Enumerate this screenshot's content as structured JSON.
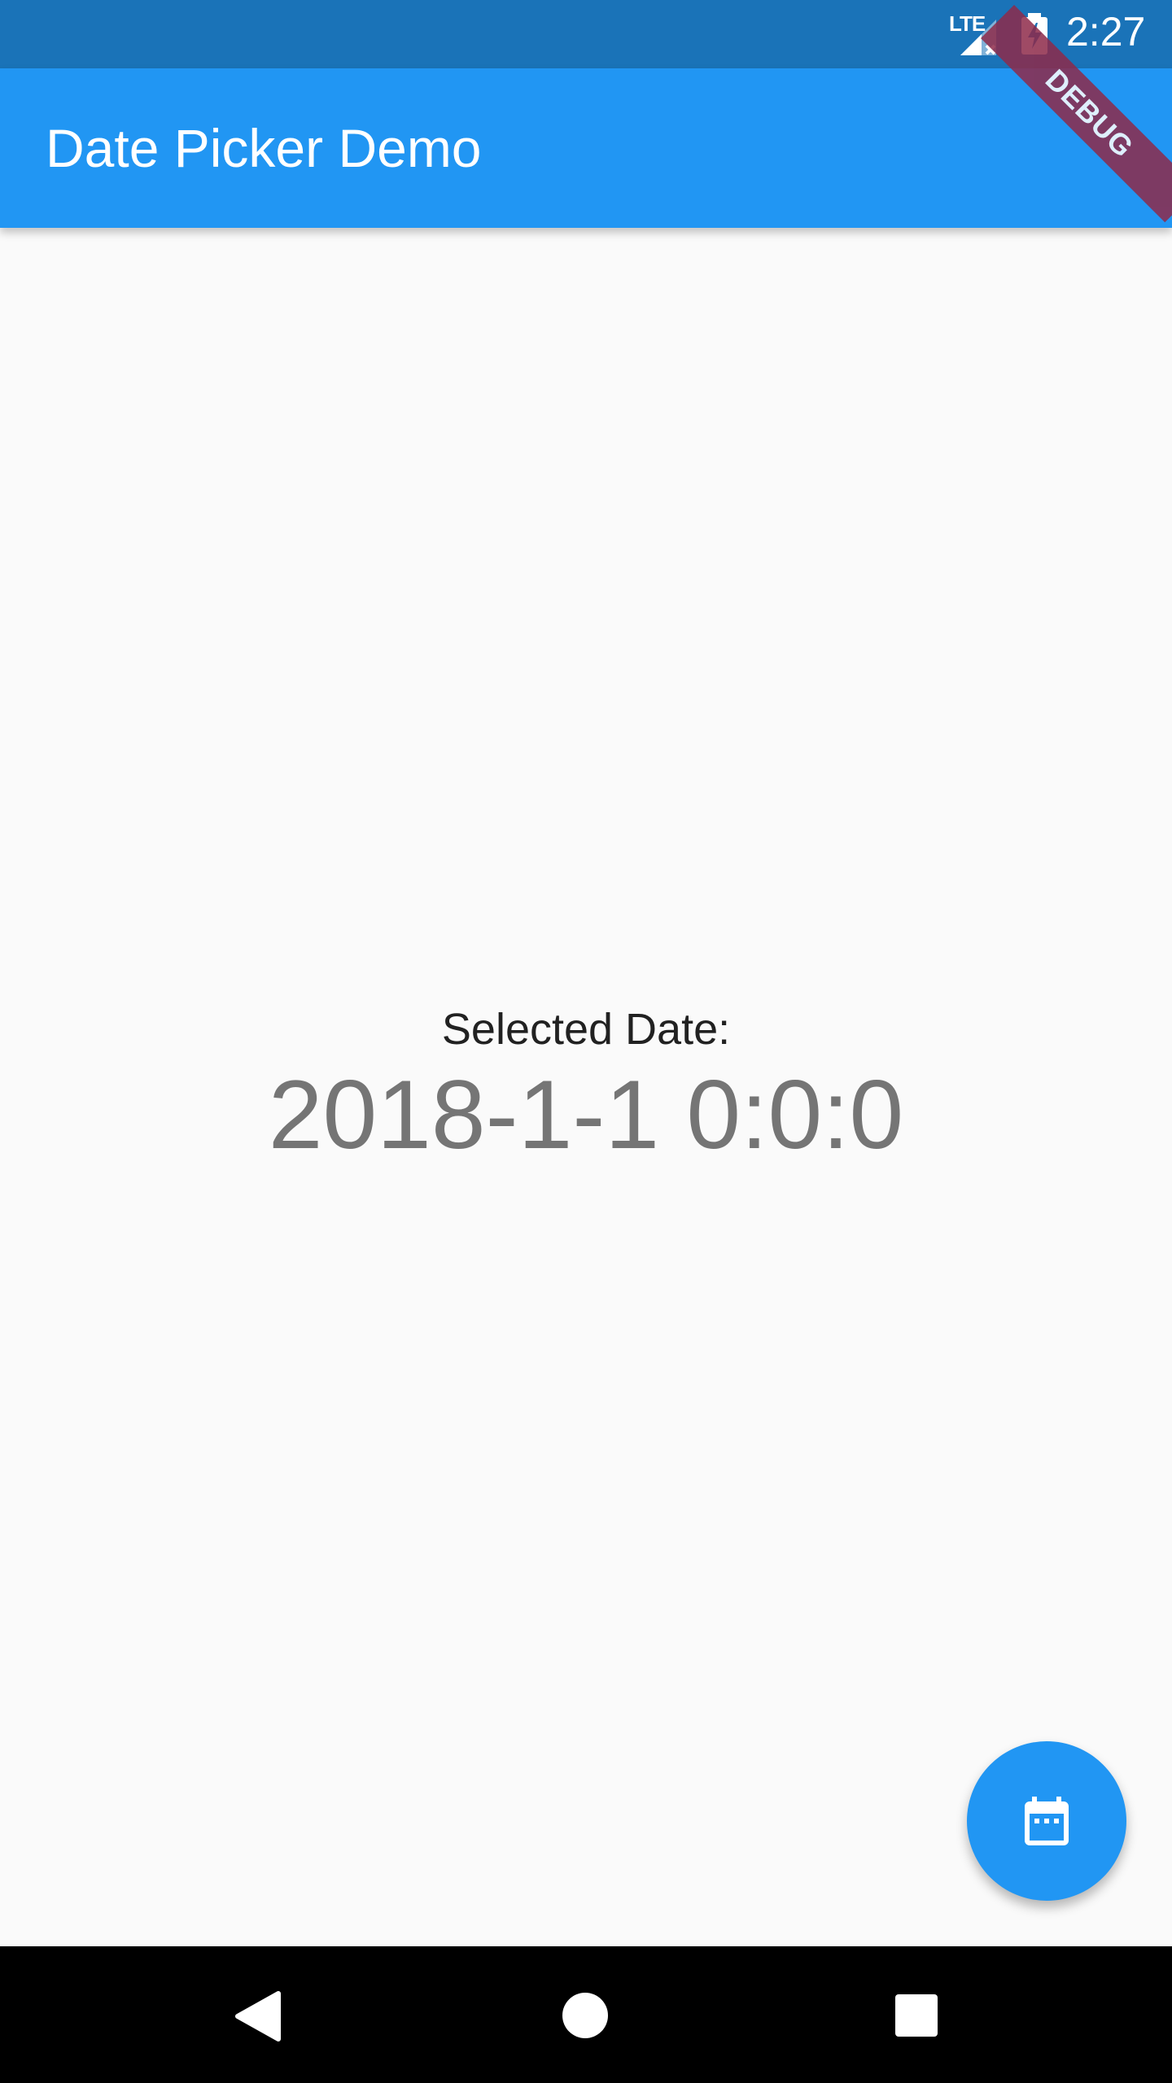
{
  "status_bar": {
    "network_label": "LTE",
    "time": "2:27",
    "icons": [
      "signal-icon",
      "battery-charging-icon"
    ],
    "background_color": "#1A73B8"
  },
  "debug_banner": {
    "label": "DEBUG",
    "color": "#8E2A4A"
  },
  "app_bar": {
    "title": "Date Picker Demo",
    "background_color": "#2196F3"
  },
  "content": {
    "label": "Selected Date:",
    "value": "2018-1-1 0:0:0"
  },
  "fab": {
    "icon": "calendar-icon",
    "color": "#2196F3"
  },
  "nav_bar": {
    "icons": [
      "back-icon",
      "home-icon",
      "recents-icon"
    ]
  }
}
